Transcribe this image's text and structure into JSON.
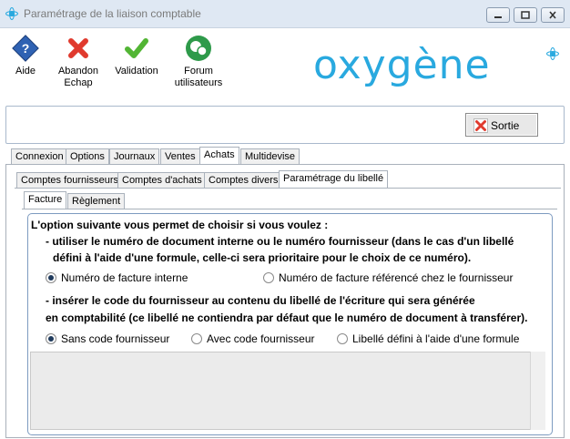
{
  "window": {
    "title": "Paramétrage de la liaison comptable"
  },
  "toolbar": {
    "aide": "Aide",
    "abandon_line1": "Abandon",
    "abandon_line2": "Echap",
    "validation": "Validation",
    "forum_line1": "Forum",
    "forum_line2": "utilisateurs"
  },
  "logo": {
    "text": "oxygène",
    "color": "#29a9df"
  },
  "sortie_label": "Sortie",
  "main_tabs": [
    "Connexion",
    "Options",
    "Journaux",
    "Ventes",
    "Achats",
    "Multidevise"
  ],
  "main_tab_active": "Achats",
  "sub_tabs": [
    "Comptes fournisseurs",
    "Comptes d'achats",
    "Comptes divers",
    "Paramétrage du libellé"
  ],
  "sub_tab_active": "Paramétrage du libellé",
  "inner_tabs": [
    "Facture",
    "Règlement"
  ],
  "inner_tab_active": "Facture",
  "content": {
    "intro": "L'option suivante vous permet de choisir si vous voulez :",
    "bullet1_line1": "- utiliser le numéro de document interne ou le numéro fournisseur (dans le cas d'un libellé",
    "bullet1_line2": "défini à l'aide d'une formule, celle-ci sera prioritaire pour le choix de ce numéro).",
    "radio_group1": [
      {
        "label": "Numéro de facture interne",
        "checked": true
      },
      {
        "label": "Numéro de facture référencé chez le fournisseur",
        "checked": false
      }
    ],
    "bullet2_line1": "- insérer le code du fournisseur au contenu du libellé de l'écriture qui sera générée",
    "bullet2_line2": "en comptabilité (ce libellé ne contiendra par défaut que le numéro de document à transférer).",
    "radio_group2": [
      {
        "label": "Sans code fournisseur",
        "checked": true
      },
      {
        "label": "Avec code fournisseur",
        "checked": false
      },
      {
        "label": "Libellé défini à l'aide d'une formule",
        "checked": false
      }
    ]
  },
  "colors": {
    "accent": "#29a9df",
    "abandon": "#e03a2e",
    "validation": "#52b534",
    "forum": "#2e9a4a",
    "help": "#2f62b3"
  }
}
